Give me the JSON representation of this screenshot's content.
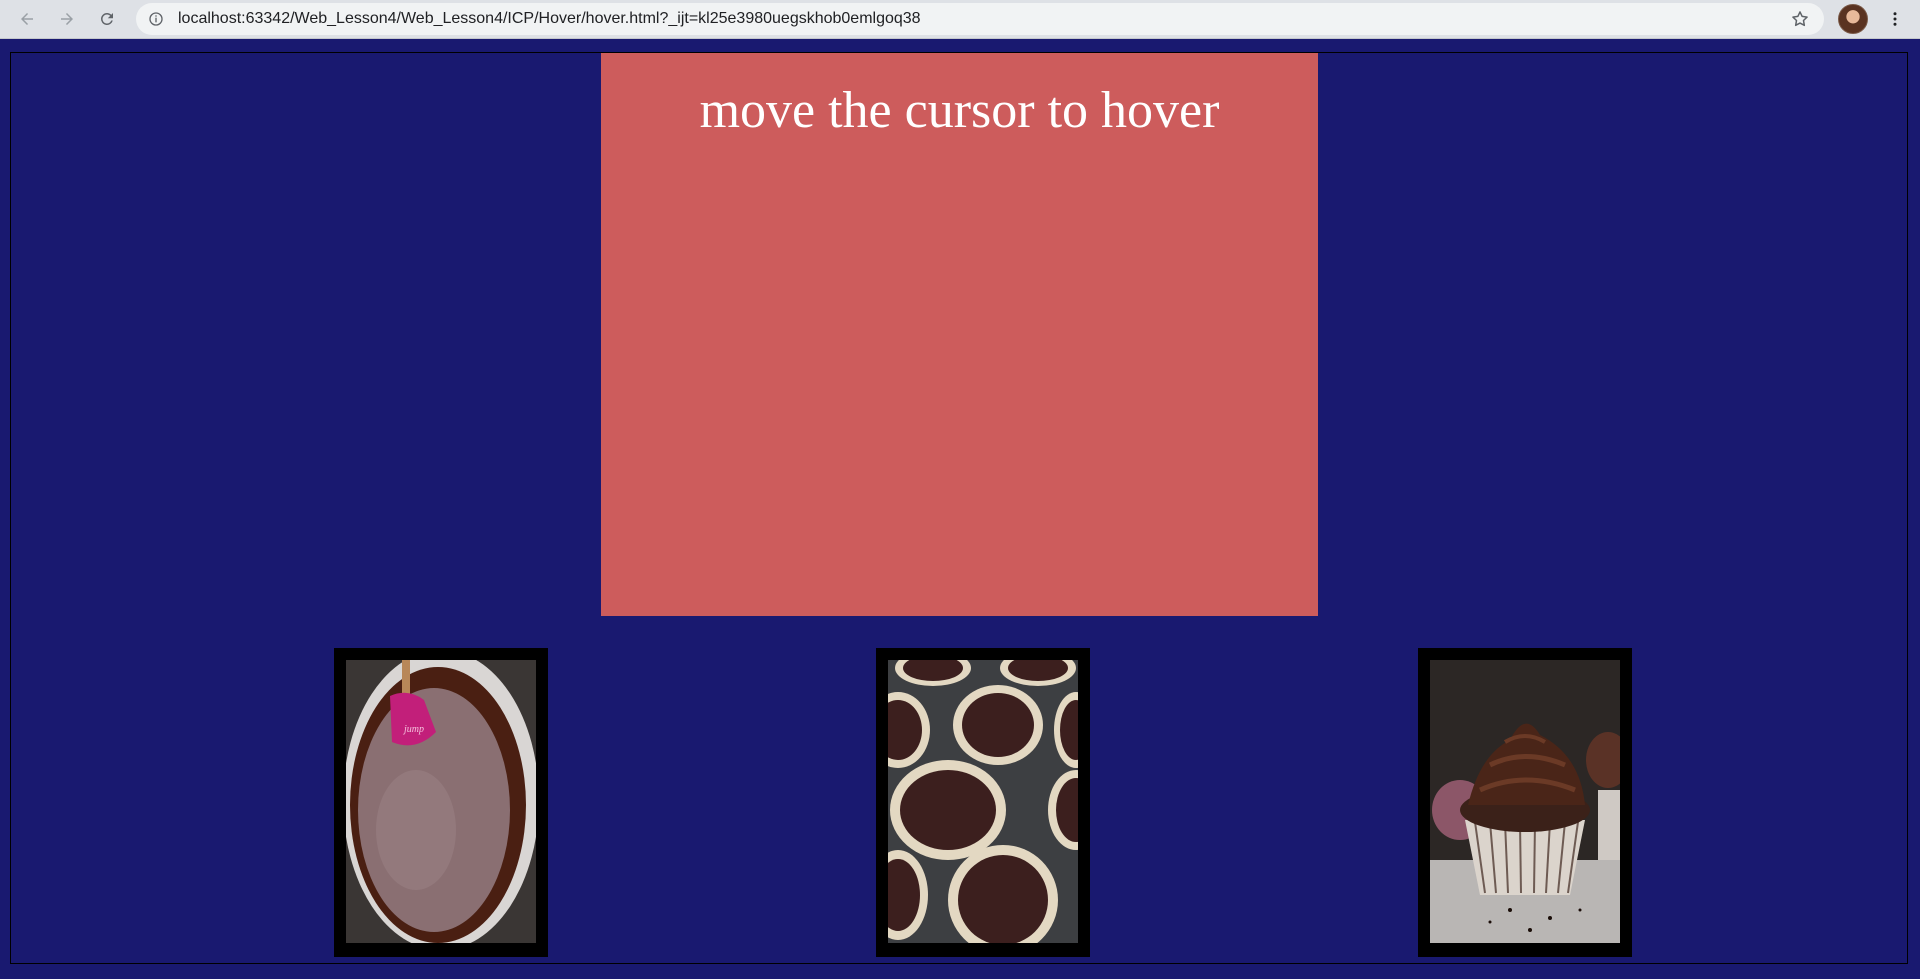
{
  "browser": {
    "url": "localhost:63342/Web_Lesson4/Web_Lesson4/ICP/Hover/hover.html?_ijt=kl25e3980uegskhob0emlgoq38",
    "icons": [
      "back-icon",
      "forward-icon",
      "reload-icon",
      "info-icon",
      "star-icon",
      "avatar",
      "kebab-menu-icon"
    ]
  },
  "page": {
    "background_color": "#191970",
    "hover_box": {
      "text": "move the cursor to hover",
      "color": "#cd5c5c"
    },
    "images": [
      {
        "subject": "chocolate batter in glass bowl with pink spatula"
      },
      {
        "subject": "chocolate batter in cupcake liners in muffin tin"
      },
      {
        "subject": "chocolate cupcake with chocolate frosting"
      }
    ]
  }
}
